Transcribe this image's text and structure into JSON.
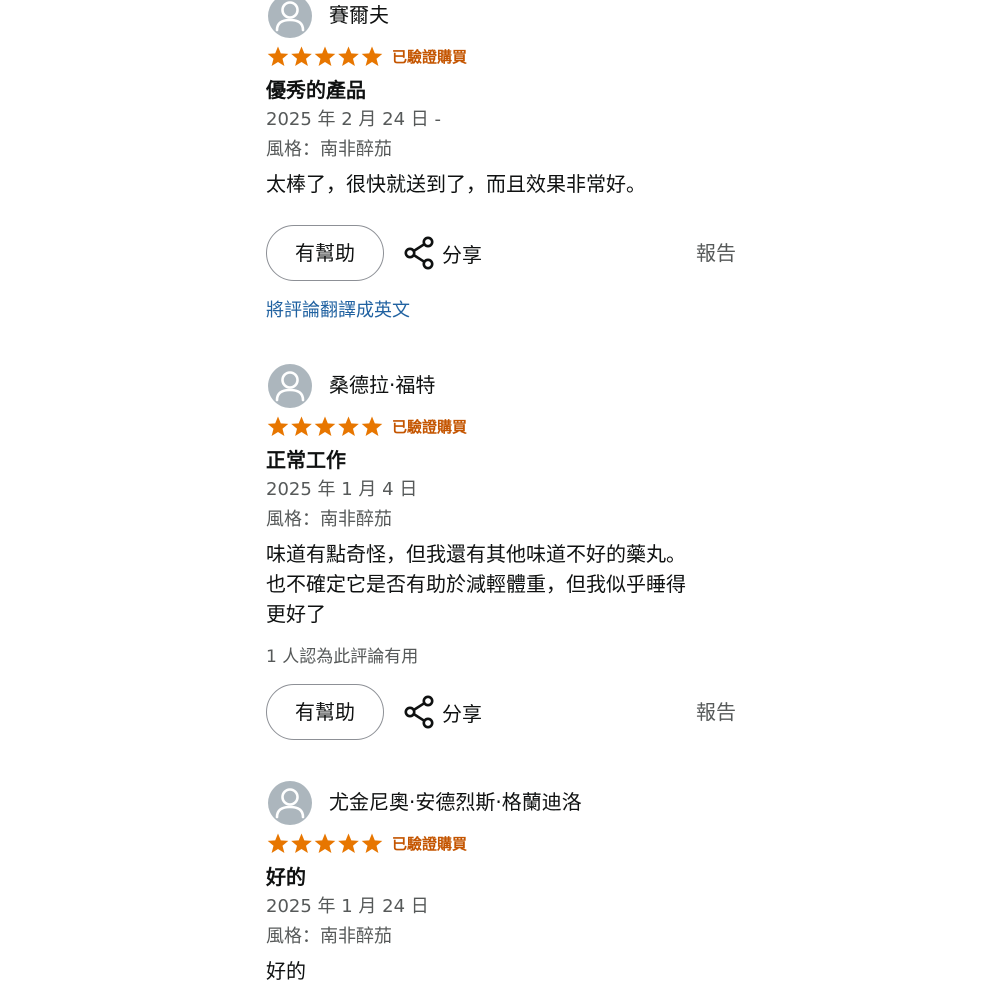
{
  "reviews": [
    {
      "reviewer": "賽爾夫",
      "rating": 5,
      "verified": "已驗證購買",
      "title": "優秀的產品",
      "date": "2025 年 2 月 24 日 -",
      "style": "風格：南非醉茄",
      "body": "太棒了，很快就送到了，而且效果非常好。",
      "helpful_label": "有幫助",
      "share_label": "分享",
      "report_label": "報告",
      "translate_label": "將評論翻譯成英文"
    },
    {
      "reviewer": "桑德拉·福特",
      "rating": 5,
      "verified": "已驗證購買",
      "title": "正常工作",
      "date": "2025 年 1 月 4 日",
      "style": "風格：南非醉茄",
      "body_lines": [
        "味道有點奇怪，但我還有其他味道不好的藥丸。",
        "也不確定它是否有助於減輕體重，但我似乎睡得",
        "更好了"
      ],
      "helpful_count": "1 人認為此評論有用",
      "helpful_label": "有幫助",
      "share_label": "分享",
      "report_label": "報告"
    },
    {
      "reviewer": "尤金尼奧·安德烈斯·格蘭迪洛",
      "rating": 5,
      "verified": "已驗證購買",
      "title": "好的",
      "date": "2025 年 1 月 24 日",
      "style": "風格：南非醉茄",
      "body": "好的"
    }
  ],
  "colors": {
    "star": "#e77600",
    "verified": "#c45500",
    "link": "#2162a1",
    "avatar": "#acb6bd",
    "muted_text": "#565959"
  },
  "icons": {
    "avatar": "user-avatar-icon",
    "star": "star-icon",
    "share": "share-icon"
  }
}
